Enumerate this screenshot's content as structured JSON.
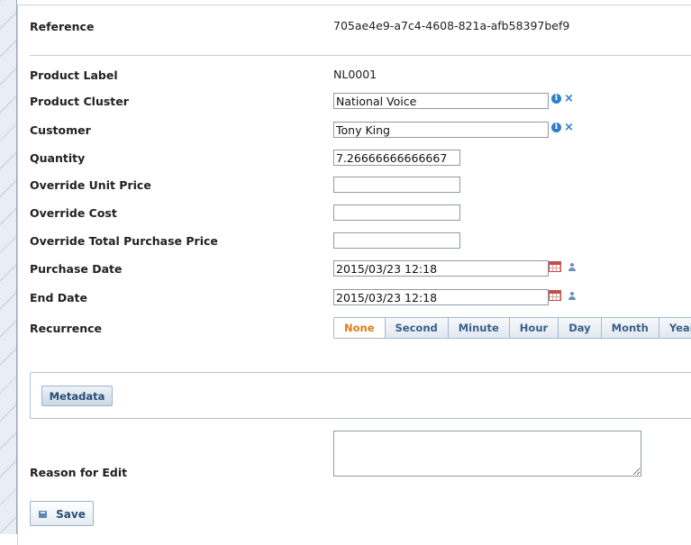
{
  "reference": {
    "label": "Reference",
    "value": "705ae4e9-a7c4-4608-821a-afb58397bef9"
  },
  "product_label": {
    "label": "Product Label",
    "value": "NL0001"
  },
  "product_cluster": {
    "label": "Product Cluster",
    "value": "National Voice",
    "info_icon": "info-icon",
    "clear_icon": "clear-x-icon"
  },
  "customer": {
    "label": "Customer",
    "value": "Tony King",
    "info_icon": "info-icon",
    "clear_icon": "clear-x-icon"
  },
  "quantity": {
    "label": "Quantity",
    "value": "7.26666666666667"
  },
  "override_unit_price": {
    "label": "Override Unit Price",
    "value": ""
  },
  "override_cost": {
    "label": "Override Cost",
    "value": ""
  },
  "override_total_purchase_price": {
    "label": "Override Total Purchase Price",
    "value": ""
  },
  "purchase_date": {
    "label": "Purchase Date",
    "value": "2015/03/23 12:18",
    "calendar_icon": "calendar-icon",
    "user_icon": "user-icon"
  },
  "end_date": {
    "label": "End Date",
    "value": "2015/03/23 12:18",
    "calendar_icon": "calendar-icon",
    "user_icon": "user-icon"
  },
  "recurrence": {
    "label": "Recurrence",
    "options": [
      "None",
      "Second",
      "Minute",
      "Hour",
      "Day",
      "Month",
      "Year"
    ],
    "selected": "None"
  },
  "metadata": {
    "button_label": "Metadata"
  },
  "reason_for_edit": {
    "label": "Reason for Edit",
    "value": ""
  },
  "save": {
    "label": "Save",
    "icon": "save-icon"
  },
  "colors": {
    "accent_blue": "#2e7fc9",
    "button_text": "#2b4f78",
    "selected_orange": "#e07b1a",
    "calendar_red": "#c0504d"
  }
}
